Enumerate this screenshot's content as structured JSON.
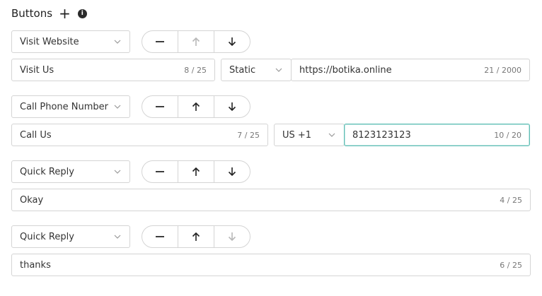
{
  "header": {
    "title": "Buttons",
    "add_icon": "plus-icon",
    "info_icon": "info-icon"
  },
  "buttons": [
    {
      "type": "Visit Website",
      "label": "Visit Us",
      "label_count": "8 / 25",
      "url_type": "Static",
      "url": "https://botika.online",
      "url_count": "21 / 2000",
      "move_up_enabled": false,
      "move_down_enabled": true
    },
    {
      "type": "Call Phone Number",
      "label": "Call Us",
      "label_count": "7 / 25",
      "country_code": "US +1",
      "phone": "8123123123",
      "phone_count": "10 / 20",
      "move_up_enabled": true,
      "move_down_enabled": true
    },
    {
      "type": "Quick Reply",
      "label": "Okay",
      "label_count": "4 / 25",
      "move_up_enabled": true,
      "move_down_enabled": true
    },
    {
      "type": "Quick Reply",
      "label": "thanks",
      "label_count": "6 / 25",
      "move_up_enabled": true,
      "move_down_enabled": false
    }
  ],
  "colors": {
    "focus_border": "#5fbdb4",
    "border": "#d4d4d4",
    "disabled_icon": "#b8b8b8",
    "icon": "#222222"
  }
}
